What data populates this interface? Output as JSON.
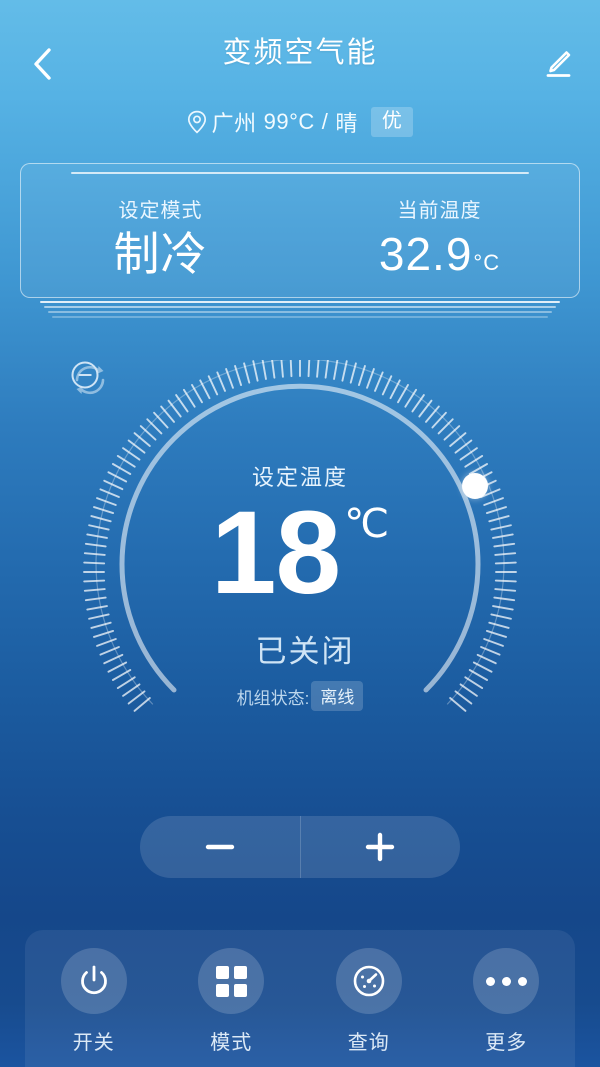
{
  "header": {
    "title": "变频空气能",
    "back_icon": "chevron-left-icon",
    "edit_icon": "pencil-edit-icon"
  },
  "weather": {
    "location_icon": "location-pin-icon",
    "city": "广州",
    "temperature": "99°C",
    "separator": "/",
    "condition": "晴",
    "air_quality": "优"
  },
  "info_card": {
    "mode": {
      "label": "设定模式",
      "value": "制冷"
    },
    "current_temp": {
      "label": "当前温度",
      "value": "32.9",
      "unit": "°C"
    }
  },
  "dial": {
    "refresh_icon": "refresh-sync-icon",
    "set_label": "设定温度",
    "set_value": "18",
    "set_unit": "℃",
    "power_icon": "minus-circle-icon",
    "power_state": "已关闭",
    "unit_status_label": "机组状态:",
    "unit_status_value": "离线"
  },
  "stepper": {
    "minus_label": "−",
    "plus_label": "+"
  },
  "toolbar": {
    "items": [
      {
        "label": "开关",
        "icon": "power-icon"
      },
      {
        "label": "模式",
        "icon": "grid-icon"
      },
      {
        "label": "查询",
        "icon": "gauge-icon"
      },
      {
        "label": "更多",
        "icon": "ellipsis-icon"
      }
    ]
  },
  "colors": {
    "gradient_top": "#63bce8",
    "gradient_mid": "#2e7cbe",
    "gradient_bottom": "#15478a",
    "accent_white": "#ffffff"
  }
}
